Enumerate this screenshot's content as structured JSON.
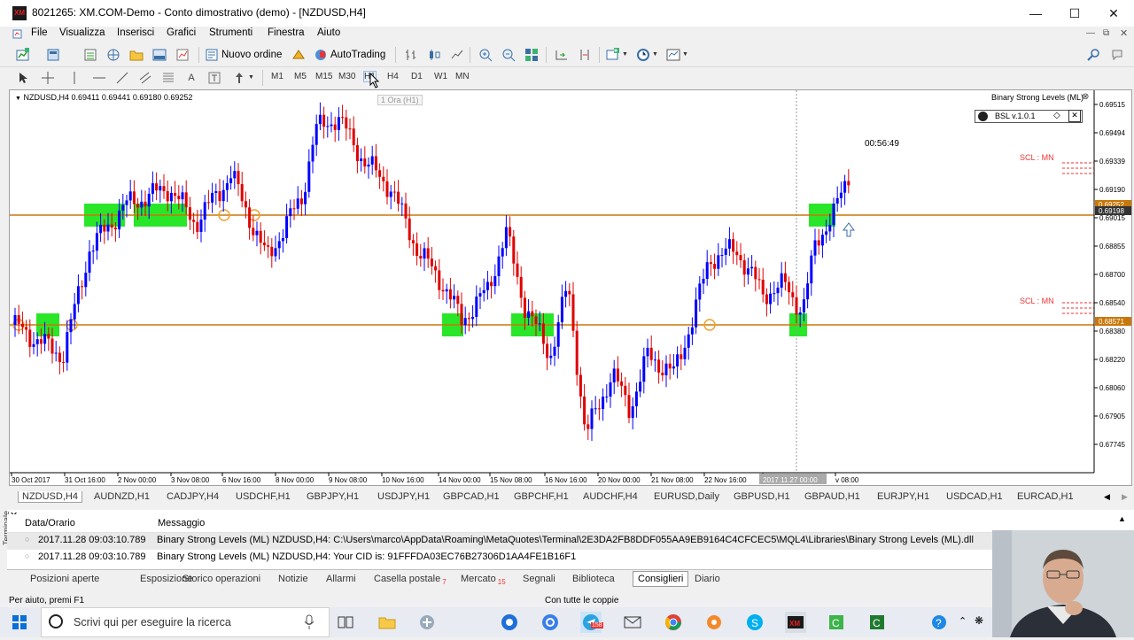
{
  "window": {
    "title": "8021265: XM.COM-Demo - Conto dimostrativo (demo) - [NZDUSD,H4]",
    "app_icon_text": "XM"
  },
  "menu": [
    "File",
    "Visualizza",
    "Inserisci",
    "Grafici",
    "Strumenti",
    "Finestra",
    "Aiuto"
  ],
  "toolbar": {
    "new_order": "Nuovo ordine",
    "autotrading": "AutoTrading"
  },
  "timeframes": [
    "M1",
    "M5",
    "M15",
    "M30",
    "H1",
    "H4",
    "D1",
    "W1",
    "MN"
  ],
  "tooltip": "1 Ora (H1)",
  "chart": {
    "symbol_info": "NZDUSD,H4  0.69411 0.69441 0.69180 0.69252",
    "indicator_label": "Binary Strong Levels (ML)",
    "bsl_panel": "BSL v.1.0.1",
    "countdown": "00:56:49",
    "scl_top": "SCL : MN",
    "scl_bottom": "SCL : MN",
    "price_ticks": [
      "0.69515",
      "0.69494",
      "0.69339",
      "0.69190",
      "0.69015",
      "0.68855",
      "0.68700",
      "0.68540",
      "0.68380",
      "0.68220",
      "0.68060",
      "0.67905",
      "0.67745"
    ],
    "price_tags": [
      "0.69252",
      "0.69198",
      "0.68571"
    ],
    "time_ticks": [
      "30 Oct 2017",
      "31 Oct 16:00",
      "2 Nov 00:00",
      "3 Nov 08:00",
      "6 Nov 16:00",
      "8 Nov 00:00",
      "9 Nov 08:00",
      "10 Nov 16:00",
      "14 Nov 00:00",
      "15 Nov 08:00",
      "16 Nov 16:00",
      "20 Nov 00:00",
      "21 Nov 08:00",
      "22 Nov 16:00",
      "2017.11.27 00:00",
      "v 08:00"
    ],
    "colors": {
      "bull": "#0000ff",
      "bear": "#e00000",
      "level": "#c8780a",
      "zone": "#29e629"
    }
  },
  "chart_tabs": [
    "NZDUSD,H4",
    "AUDNZD,H1",
    "CADJPY,H4",
    "USDCHF,H1",
    "GBPJPY,H1",
    "USDJPY,H1",
    "GBPCAD,H1",
    "GBPCHF,H1",
    "AUDCHF,H4",
    "EURUSD,Daily",
    "GBPUSD,H1",
    "GBPAUD,H1",
    "EURJPY,H1",
    "USDCAD,H1",
    "EURCAD,H1"
  ],
  "terminal": {
    "col_time": "Data/Orario",
    "col_message": "Messaggio",
    "rows": [
      {
        "time": "2017.11.28 09:03:10.789",
        "message": "Binary Strong Levels (ML) NZDUSD,H4: C:\\Users\\marco\\AppData\\Roaming\\MetaQuotes\\Terminal\\2E3DA2FB8DDF055AA9EB9164C4CFCEC5\\MQL4\\Libraries\\Binary Strong Levels (ML).dll"
      },
      {
        "time": "2017.11.28 09:03:10.789",
        "message": "Binary Strong Levels (ML) NZDUSD,H4: Your CID is: 91FFFDA03EC76B27306D1AA4FE1B16F1"
      }
    ],
    "side_label": "Terminale",
    "tabs": [
      {
        "label": "Posizioni aperte"
      },
      {
        "label": "Esposizione"
      },
      {
        "label": "Storico operazioni"
      },
      {
        "label": "Notizie"
      },
      {
        "label": "Allarmi"
      },
      {
        "label": "Casella postale",
        "badge": "7"
      },
      {
        "label": "Mercato",
        "badge": "15"
      },
      {
        "label": "Segnali"
      },
      {
        "label": "Biblioteca"
      },
      {
        "label": "Consiglieri"
      },
      {
        "label": "Diario"
      }
    ]
  },
  "status": {
    "help": "Per aiuto, premi F1",
    "profile": "Con tutte le coppie"
  },
  "taskbar": {
    "search_placeholder": "Scrivi qui per eseguire la ricerca",
    "telegram_badge": "158"
  }
}
